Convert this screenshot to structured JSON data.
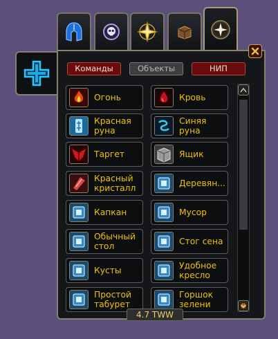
{
  "tabs": [
    {
      "id": "helm-tab",
      "icon": "helm-icon"
    },
    {
      "id": "skull-tab",
      "icon": "skull-icon"
    },
    {
      "id": "compass-tab",
      "icon": "compass-icon"
    },
    {
      "id": "crate-tab",
      "icon": "crate-icon"
    },
    {
      "id": "star-tab",
      "icon": "compass-star-icon"
    }
  ],
  "sidebar": {
    "icon": "plus-icon"
  },
  "filters": {
    "teams": "Команды",
    "objects": "Объекты",
    "npc": "НИП"
  },
  "items": [
    {
      "label": "Огонь",
      "icon": "fire-icon"
    },
    {
      "label": "Кровь",
      "icon": "blood-icon"
    },
    {
      "label": "Красная\nруна",
      "icon": "red-rune-icon"
    },
    {
      "label": "Синяя\nруна",
      "icon": "blue-rune-icon"
    },
    {
      "label": "Таргет",
      "icon": "target-icon"
    },
    {
      "label": "Ящик",
      "icon": "crate-icon"
    },
    {
      "label": "Красный\nкристалл",
      "icon": "red-crystal-icon"
    },
    {
      "label": "Деревян...",
      "icon": "blueprint-icon"
    },
    {
      "label": "Капкан",
      "icon": "blueprint-icon"
    },
    {
      "label": "Мусор",
      "icon": "blueprint-icon"
    },
    {
      "label": "Обычный\nстол",
      "icon": "blueprint-icon"
    },
    {
      "label": "Стог сена",
      "icon": "blueprint-icon"
    },
    {
      "label": "Кусты",
      "icon": "blueprint-icon"
    },
    {
      "label": "Удобное\nкресло",
      "icon": "blueprint-icon"
    },
    {
      "label": "Простой\nтабурет",
      "icon": "blueprint-icon"
    },
    {
      "label": "Горшок\nзелени",
      "icon": "blueprint-icon"
    }
  ],
  "version": "4.7 TWW",
  "colors": {
    "label": "#efc300",
    "filter_active": "#6b0c0c",
    "filter_inactive": "#3e3e3e"
  }
}
